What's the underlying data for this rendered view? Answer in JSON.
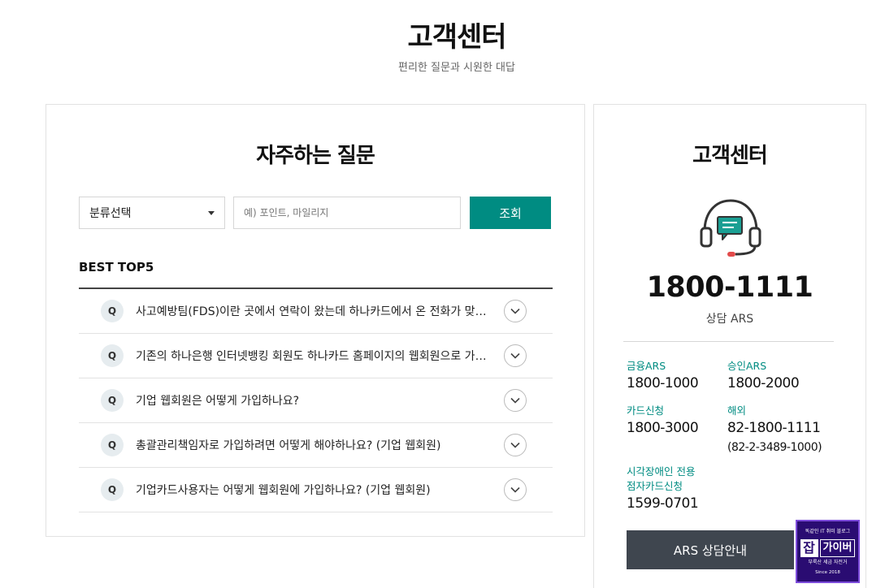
{
  "header": {
    "title": "고객센터",
    "subtitle": "편리한 질문과 시원한 대답"
  },
  "faq": {
    "title": "자주하는 질문",
    "category_select": "분류선택",
    "search": {
      "placeholder": "예) 포인트, 마일리지",
      "button_label": "조회"
    },
    "best_heading": "BEST TOP5",
    "badge_label": "Q",
    "items": [
      {
        "question": "사고예방팀(FDS)이란 곳에서 연락이 왔는데 하나카드에서 온 전화가 맞나요?"
      },
      {
        "question": "기존의 하나은행 인터넷뱅킹 회원도 하나카드 홈페이지의 웹회원으로 가입해야 하나요?"
      },
      {
        "question": "기업 웹회원은 어떻게 가입하나요?"
      },
      {
        "question": "총괄관리책임자로 가입하려면 어떻게 해야하나요? (기업 웹회원)"
      },
      {
        "question": "기업카드사용자는 어떻게 웹회원에 가입하나요? (기업 웹회원)"
      }
    ]
  },
  "customer_center": {
    "title": "고객센터",
    "icon": "headset-icon",
    "main_number": "1800-1111",
    "main_label": "상담 ARS",
    "finance_ars": {
      "label": "금융ARS",
      "number": "1800-1000"
    },
    "approval_ars": {
      "label": "승인ARS",
      "number": "1800-2000"
    },
    "card_application": {
      "label": "카드신청",
      "number": "1800-3000"
    },
    "overseas": {
      "label": "해외",
      "number": "82-1800-1111",
      "sub": "(82-2-3489-1000)"
    },
    "braille_card": {
      "label_line1": "시각장애인 전용",
      "label_line2": "점자카드신청",
      "number": "1599-0701"
    },
    "ars_button_label": "ARS 상담안내"
  },
  "watermark": {
    "top_text": "똑같인 IT 취미 블로그",
    "box_char": "잡",
    "word": "가이버",
    "sub_text": "부룩산 세금 자전거",
    "since": "Since 2018"
  },
  "colors": {
    "accent": "#008c82",
    "dark_button": "#3f464f",
    "logo_bg": "#2a0c72"
  }
}
